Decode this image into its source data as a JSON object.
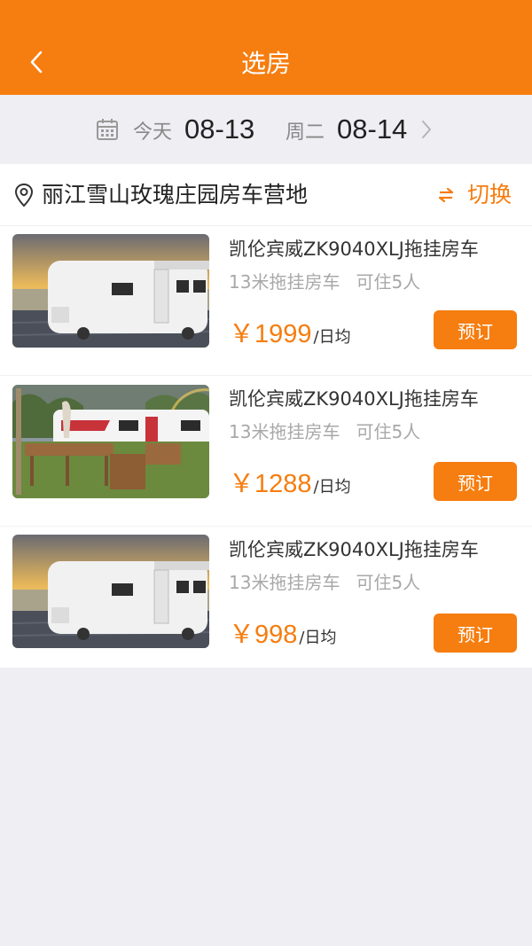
{
  "header": {
    "title": "选房"
  },
  "dates": {
    "checkin_label": "今天",
    "checkin_value": "08-13",
    "checkout_label": "周二",
    "checkout_value": "08-14"
  },
  "location": {
    "name": "丽江雪山玫瑰庄园房车营地",
    "switch_label": "切换"
  },
  "colors": {
    "accent": "#f67d0f",
    "background": "#eeeef3"
  },
  "listings": [
    {
      "title": "凯伦宾威ZK9040XLJ拖挂房车",
      "length": "13米拖挂房车",
      "capacity": "可住5人",
      "price": "￥1999",
      "unit": "/日均",
      "book_label": "预订",
      "image": "camper-trailer-lakeside-sunset"
    },
    {
      "title": "凯伦宾威ZK9040XLJ拖挂房车",
      "length": "13米拖挂房车",
      "capacity": "可住5人",
      "price": "￥1288",
      "unit": "/日均",
      "book_label": "预订",
      "image": "camper-with-wooden-deck"
    },
    {
      "title": "凯伦宾威ZK9040XLJ拖挂房车",
      "length": "13米拖挂房车",
      "capacity": "可住5人",
      "price": "￥998",
      "unit": "/日均",
      "book_label": "预订",
      "image": "camper-trailer-lakeside-sunset"
    }
  ],
  "icons": {
    "back": "chevron-left-icon",
    "calendar": "calendar-icon",
    "next": "chevron-right-icon",
    "location": "map-pin-icon",
    "switch": "swap-arrows-icon"
  }
}
